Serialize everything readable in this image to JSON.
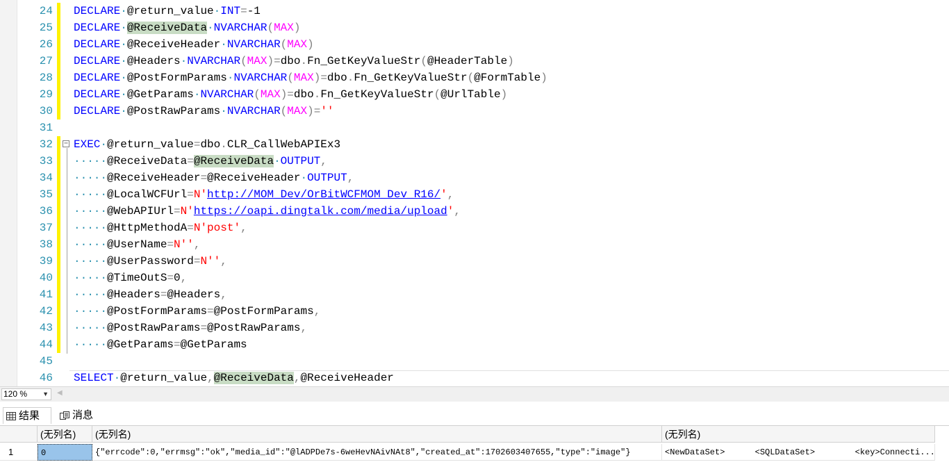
{
  "editor": {
    "lines": [
      {
        "n": "24",
        "tokens": [
          [
            "kw",
            "DECLARE"
          ],
          [
            "dot",
            "·"
          ],
          [
            "",
            "@return_value"
          ],
          [
            "dot",
            "·"
          ],
          [
            "kw",
            "INT"
          ],
          [
            "op",
            "="
          ],
          [
            "",
            "-1"
          ]
        ]
      },
      {
        "n": "25",
        "tokens": [
          [
            "kw",
            "DECLARE"
          ],
          [
            "dot",
            "·"
          ],
          [
            "hl",
            "@ReceiveData"
          ],
          [
            "dot",
            "·"
          ],
          [
            "kw",
            "NVARCHAR"
          ],
          [
            "op",
            "("
          ],
          [
            "fn",
            "MAX"
          ],
          [
            "op",
            ")"
          ]
        ]
      },
      {
        "n": "26",
        "tokens": [
          [
            "kw",
            "DECLARE"
          ],
          [
            "dot",
            "·"
          ],
          [
            "",
            "@ReceiveHeader"
          ],
          [
            "dot",
            "·"
          ],
          [
            "kw",
            "NVARCHAR"
          ],
          [
            "op",
            "("
          ],
          [
            "fn",
            "MAX"
          ],
          [
            "op",
            ")"
          ]
        ]
      },
      {
        "n": "27",
        "tokens": [
          [
            "kw",
            "DECLARE"
          ],
          [
            "dot",
            "·"
          ],
          [
            "",
            "@Headers"
          ],
          [
            "dot",
            "·"
          ],
          [
            "kw",
            "NVARCHAR"
          ],
          [
            "op",
            "("
          ],
          [
            "fn",
            "MAX"
          ],
          [
            "op",
            ")"
          ],
          [
            "op",
            "="
          ],
          [
            "",
            "dbo"
          ],
          [
            "op",
            "."
          ],
          [
            "",
            "Fn_GetKeyValueStr"
          ],
          [
            "op",
            "("
          ],
          [
            "",
            "@HeaderTable"
          ],
          [
            "op",
            ")"
          ]
        ]
      },
      {
        "n": "28",
        "tokens": [
          [
            "kw",
            "DECLARE"
          ],
          [
            "dot",
            "·"
          ],
          [
            "",
            "@PostFormParams"
          ],
          [
            "dot",
            "·"
          ],
          [
            "kw",
            "NVARCHAR"
          ],
          [
            "op",
            "("
          ],
          [
            "fn",
            "MAX"
          ],
          [
            "op",
            ")"
          ],
          [
            "op",
            "="
          ],
          [
            "",
            "dbo"
          ],
          [
            "op",
            "."
          ],
          [
            "",
            "Fn_GetKeyValueStr"
          ],
          [
            "op",
            "("
          ],
          [
            "",
            "@FormTable"
          ],
          [
            "op",
            ")"
          ]
        ]
      },
      {
        "n": "29",
        "tokens": [
          [
            "kw",
            "DECLARE"
          ],
          [
            "dot",
            "·"
          ],
          [
            "",
            "@GetParams"
          ],
          [
            "dot",
            "·"
          ],
          [
            "kw",
            "NVARCHAR"
          ],
          [
            "op",
            "("
          ],
          [
            "fn",
            "MAX"
          ],
          [
            "op",
            ")"
          ],
          [
            "op",
            "="
          ],
          [
            "",
            "dbo"
          ],
          [
            "op",
            "."
          ],
          [
            "",
            "Fn_GetKeyValueStr"
          ],
          [
            "op",
            "("
          ],
          [
            "",
            "@UrlTable"
          ],
          [
            "op",
            ")"
          ]
        ]
      },
      {
        "n": "30",
        "tokens": [
          [
            "kw",
            "DECLARE"
          ],
          [
            "dot",
            "·"
          ],
          [
            "",
            "@PostRawParams"
          ],
          [
            "dot",
            "·"
          ],
          [
            "kw",
            "NVARCHAR"
          ],
          [
            "op",
            "("
          ],
          [
            "fn",
            "MAX"
          ],
          [
            "op",
            ")"
          ],
          [
            "op",
            "="
          ],
          [
            "str",
            "''"
          ]
        ]
      },
      {
        "n": "31",
        "tokens": []
      },
      {
        "n": "32",
        "fold": true,
        "tokens": [
          [
            "kw",
            "EXEC"
          ],
          [
            "dot",
            "·"
          ],
          [
            "",
            "@return_value"
          ],
          [
            "op",
            "="
          ],
          [
            "",
            "dbo"
          ],
          [
            "op",
            "."
          ],
          [
            "",
            "CLR_CallWebAPIEx3"
          ]
        ]
      },
      {
        "n": "33",
        "tokens": [
          [
            "dot",
            "·····"
          ],
          [
            "",
            "@ReceiveData"
          ],
          [
            "op",
            "="
          ],
          [
            "hl",
            "@ReceiveData"
          ],
          [
            "dot",
            "·"
          ],
          [
            "kw",
            "OUTPUT"
          ],
          [
            "op",
            ","
          ]
        ]
      },
      {
        "n": "34",
        "tokens": [
          [
            "dot",
            "·····"
          ],
          [
            "",
            "@ReceiveHeader"
          ],
          [
            "op",
            "="
          ],
          [
            "",
            "@ReceiveHeader"
          ],
          [
            "dot",
            "·"
          ],
          [
            "kw",
            "OUTPUT"
          ],
          [
            "op",
            ","
          ]
        ]
      },
      {
        "n": "35",
        "tokens": [
          [
            "dot",
            "·····"
          ],
          [
            "",
            "@LocalWCFUrl"
          ],
          [
            "op",
            "="
          ],
          [
            "str",
            "N'"
          ],
          [
            "link",
            "http://MOM_Dev/OrBitWCFMOM_Dev_R16/"
          ],
          [
            "str",
            "'"
          ],
          [
            "op",
            ","
          ]
        ]
      },
      {
        "n": "36",
        "tokens": [
          [
            "dot",
            "·····"
          ],
          [
            "",
            "@WebAPIUrl"
          ],
          [
            "op",
            "="
          ],
          [
            "str",
            "N'"
          ],
          [
            "link",
            "https://oapi.dingtalk.com/media/upload"
          ],
          [
            "str",
            "'"
          ],
          [
            "op",
            ","
          ]
        ]
      },
      {
        "n": "37",
        "tokens": [
          [
            "dot",
            "·····"
          ],
          [
            "",
            "@HttpMethodA"
          ],
          [
            "op",
            "="
          ],
          [
            "str",
            "N'post'"
          ],
          [
            "op",
            ","
          ]
        ]
      },
      {
        "n": "38",
        "tokens": [
          [
            "dot",
            "·····"
          ],
          [
            "",
            "@UserName"
          ],
          [
            "op",
            "="
          ],
          [
            "str",
            "N''"
          ],
          [
            "op",
            ","
          ]
        ]
      },
      {
        "n": "39",
        "tokens": [
          [
            "dot",
            "·····"
          ],
          [
            "",
            "@UserPassword"
          ],
          [
            "op",
            "="
          ],
          [
            "str",
            "N''"
          ],
          [
            "op",
            ","
          ]
        ]
      },
      {
        "n": "40",
        "tokens": [
          [
            "dot",
            "·····"
          ],
          [
            "",
            "@TimeOutS"
          ],
          [
            "op",
            "="
          ],
          [
            "",
            "0"
          ],
          [
            "op",
            ","
          ]
        ]
      },
      {
        "n": "41",
        "tokens": [
          [
            "dot",
            "·····"
          ],
          [
            "",
            "@Headers"
          ],
          [
            "op",
            "="
          ],
          [
            "",
            "@Headers"
          ],
          [
            "op",
            ","
          ]
        ]
      },
      {
        "n": "42",
        "tokens": [
          [
            "dot",
            "·····"
          ],
          [
            "",
            "@PostFormParams"
          ],
          [
            "op",
            "="
          ],
          [
            "",
            "@PostFormParams"
          ],
          [
            "op",
            ","
          ]
        ]
      },
      {
        "n": "43",
        "tokens": [
          [
            "dot",
            "·····"
          ],
          [
            "",
            "@PostRawParams"
          ],
          [
            "op",
            "="
          ],
          [
            "",
            "@PostRawParams"
          ],
          [
            "op",
            ","
          ]
        ]
      },
      {
        "n": "44",
        "tokens": [
          [
            "dot",
            "·····"
          ],
          [
            "",
            "@GetParams"
          ],
          [
            "op",
            "="
          ],
          [
            "",
            "@GetParams"
          ]
        ]
      },
      {
        "n": "45",
        "tokens": []
      },
      {
        "n": "46",
        "tokens": [
          [
            "kw",
            "SELECT"
          ],
          [
            "dot",
            "·"
          ],
          [
            "",
            "@return_value"
          ],
          [
            "op",
            ","
          ],
          [
            "hl",
            "@ReceiveData"
          ],
          [
            "op",
            ","
          ],
          [
            "",
            "@ReceiveHeader"
          ]
        ]
      }
    ]
  },
  "zoom": {
    "value": "120 %"
  },
  "tabs": [
    {
      "label": "结果",
      "icon": "grid-icon"
    },
    {
      "label": "消息",
      "icon": "messages-icon"
    }
  ],
  "grid": {
    "headers": [
      "(无列名)",
      "(无列名)",
      "(无列名)"
    ],
    "rows": [
      {
        "num": "1",
        "cells": [
          "0",
          "{\"errcode\":0,\"errmsg\":\"ok\",\"media_id\":\"@lADPDe7s-6weHevNAivNAt8\",\"created_at\":1702603407655,\"type\":\"image\"}",
          "<NewDataSet>      <SQLDataSet>        <key>Connecti..."
        ]
      }
    ]
  },
  "colors": {
    "keyword": "#0000ff",
    "string": "#ff0000",
    "function": "#ff00ff",
    "line_number": "#2b91af",
    "change_marker": "#fff200",
    "highlight": "#c8dcc4",
    "selected_cell": "#99c4ea"
  }
}
